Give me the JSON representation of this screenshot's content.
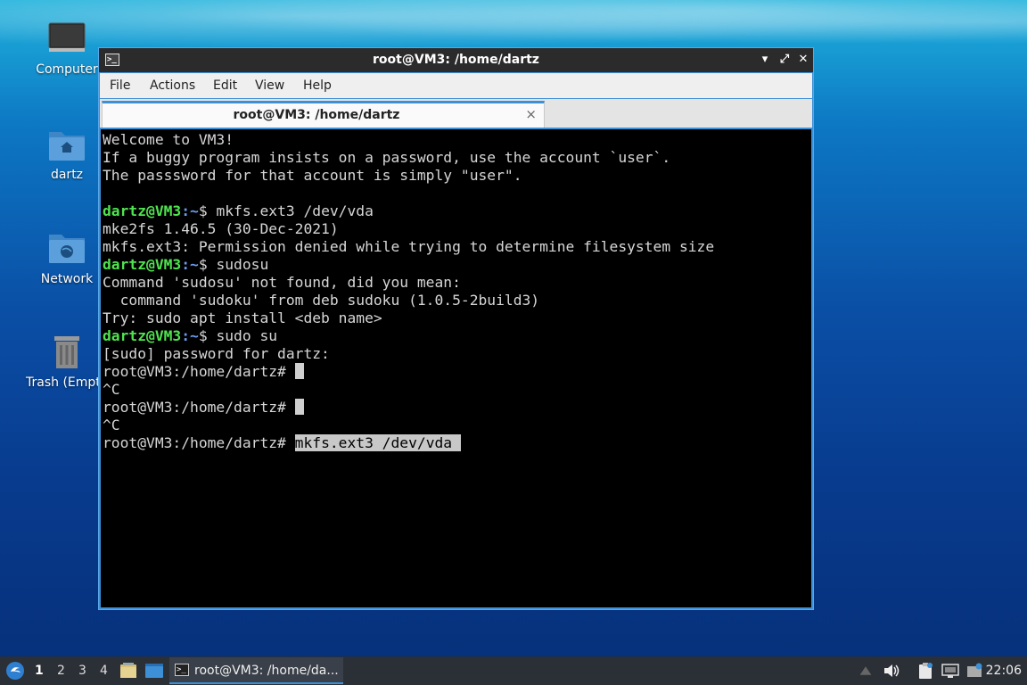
{
  "desktop": {
    "icons": [
      {
        "label": "Computer"
      },
      {
        "label": "dartz"
      },
      {
        "label": "Network"
      },
      {
        "label": "Trash (Empt"
      }
    ]
  },
  "window": {
    "title": "root@VM3: /home/dartz",
    "menu": [
      "File",
      "Actions",
      "Edit",
      "View",
      "Help"
    ],
    "tab_label": "root@VM3: /home/dartz",
    "tab_close": "×",
    "buttons": {
      "minimize": "▴",
      "maximize": "▴",
      "close": "✕"
    }
  },
  "terminal": {
    "lines": [
      {
        "text": "Welcome to VM3!"
      },
      {
        "text": "If a buggy program insists on a password, use the account `user`."
      },
      {
        "text": "The passsword for that account is simply \"user\"."
      },
      {
        "text": ""
      },
      {
        "user": "dartz@VM3",
        "path": ":~",
        "cmd": "$ mkfs.ext3 /dev/vda"
      },
      {
        "text": "mke2fs 1.46.5 (30-Dec-2021)"
      },
      {
        "text": "mkfs.ext3: Permission denied while trying to determine filesystem size"
      },
      {
        "user": "dartz@VM3",
        "path": ":~",
        "cmd": "$ sudosu"
      },
      {
        "text": "Command 'sudosu' not found, did you mean:"
      },
      {
        "text": "  command 'sudoku' from deb sudoku (1.0.5-2build3)"
      },
      {
        "text": "Try: sudo apt install <deb name>"
      },
      {
        "user": "dartz@VM3",
        "path": ":~",
        "cmd": "$ sudo su"
      },
      {
        "text": "[sudo] password for dartz:"
      },
      {
        "text": "root@VM3:/home/dartz# "
      },
      {
        "text": "^C"
      },
      {
        "text": "root@VM3:/home/dartz# "
      },
      {
        "text": "^C"
      },
      {
        "text": "root@VM3:/home/dartz# ",
        "selected": "mkfs.ext3 /dev/vda"
      }
    ]
  },
  "taskbar": {
    "workspaces": [
      "1",
      "2",
      "3",
      "4"
    ],
    "active_workspace": "1",
    "task_label": "root@VM3: /home/da...",
    "clock": "22:06"
  }
}
